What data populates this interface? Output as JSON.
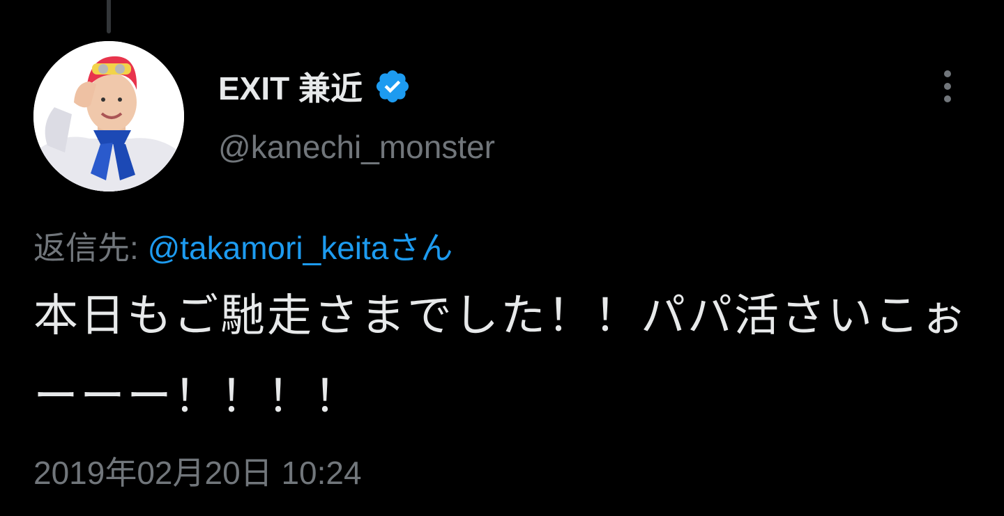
{
  "tweet": {
    "author": {
      "display_name": "EXIT 兼近",
      "handle": "@kanechi_monster",
      "verified": true,
      "avatar_icon": "profile-photo"
    },
    "reply_to": {
      "prefix": "返信先: ",
      "mention": "@takamori_keita",
      "suffix": "さん"
    },
    "text": "本日もご馳走さまでした！！パパ活さいこぉーーー！！！！",
    "timestamp": "2019年02月20日 10:24",
    "more_icon": "more-vertical-icon"
  },
  "colors": {
    "background": "#000000",
    "text": "#e7e9ea",
    "secondary": "#71767b",
    "accent": "#1d9bf0"
  }
}
